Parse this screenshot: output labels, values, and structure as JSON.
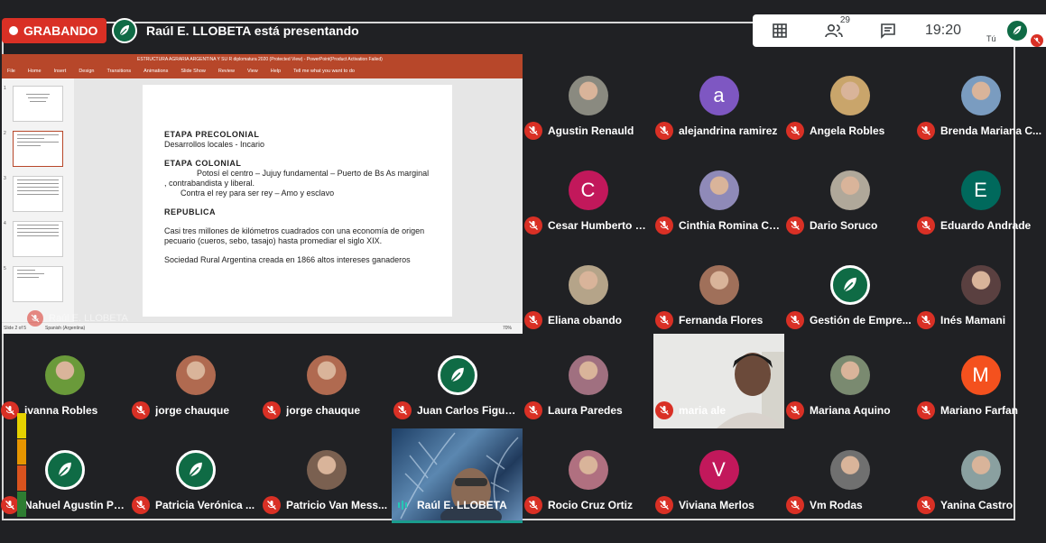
{
  "recording": {
    "label": "GRABANDO"
  },
  "presenting": {
    "text": "Raúl E. LLOBETA está presentando"
  },
  "toolbar": {
    "participant_count": "29",
    "time": "19:20",
    "self_label": "Tú"
  },
  "presentation": {
    "window_title": "ESTRUCTURA AGRARIA ARGENTINA Y SU R diplomatura 2020 (Protected View) - PowerPoint(Product Activation Failed)",
    "ribbon": [
      "File",
      "Home",
      "Insert",
      "Design",
      "Transitions",
      "Animations",
      "Slide Show",
      "Review",
      "View",
      "Help",
      "Tell me what you want to do"
    ],
    "presenter_label": "Raúl E. LLOBETA",
    "status_left": "Slide 2 of 5",
    "status_lang": "Spanish (Argentina)",
    "status_zoom": "70%",
    "slide": {
      "h1": "ETAPA PRECOLONIAL",
      "p1": "Desarrollos locales - Incario",
      "h2": "ETAPA COLONIAL",
      "p2a": "Potosí el centro – Jujuy fundamental – Puerto de Bs As marginal , contrabandista y liberal.",
      "p2b": "Contra el rey para ser rey – Amo y esclavo",
      "h3": "REPUBLICA",
      "p3": "Casi tres millones de kilómetros cuadrados con una economía de origen pecuario (cueros, sebo, tasajo) hasta promediar el siglo XIX.",
      "p4": "Sociedad Rural Argentina  creada en 1866 altos intereses ganaderos"
    }
  },
  "participants": [
    {
      "name": "Agustin Renauld",
      "avatar": "photo",
      "color": "#8a8a80"
    },
    {
      "name": "alejandrina ramirez",
      "avatar": "letter",
      "letter": "a",
      "color": "#7e57c2"
    },
    {
      "name": "Angela Robles",
      "avatar": "photo",
      "color": "#c9a56b"
    },
    {
      "name": "Brenda Mariana C...",
      "avatar": "photo",
      "color": "#7a9cc0"
    },
    {
      "name": "Cesar Humberto C...",
      "avatar": "letter",
      "letter": "C",
      "color": "#c2185b"
    },
    {
      "name": "Cinthia Romina Co...",
      "avatar": "photo",
      "color": "#8f8ab8"
    },
    {
      "name": "Dario Soruco",
      "avatar": "photo",
      "color": "#b0a89a"
    },
    {
      "name": "Eduardo Andrade",
      "avatar": "letter",
      "letter": "E",
      "color": "#00695c"
    },
    {
      "name": "Eliana obando",
      "avatar": "photo",
      "color": "#b5a489"
    },
    {
      "name": "Fernanda Flores",
      "avatar": "photo",
      "color": "#a0705a"
    },
    {
      "name": "Gestión de Empre...",
      "avatar": "logo"
    },
    {
      "name": "Inés Mamani",
      "avatar": "photo",
      "color": "#5a4040"
    },
    {
      "name": "ivanna Robles",
      "avatar": "photo",
      "color": "#6a9a3a"
    },
    {
      "name": "jorge chauque",
      "avatar": "photo",
      "color": "#b06a50"
    },
    {
      "name": "jorge chauque",
      "avatar": "photo",
      "color": "#b06a50"
    },
    {
      "name": "Juan Carlos Figuer...",
      "avatar": "logo"
    },
    {
      "name": "Laura Paredes",
      "avatar": "photo",
      "color": "#a07080"
    },
    {
      "name": "maria ale",
      "avatar": "video"
    },
    {
      "name": "Mariana Aquino",
      "avatar": "photo",
      "color": "#7a8a70"
    },
    {
      "name": "Mariano Farfan",
      "avatar": "letter",
      "letter": "M",
      "color": "#f4511e"
    },
    {
      "name": "Nahuel Agustin PO...",
      "avatar": "logo"
    },
    {
      "name": "Patricia Verónica ...",
      "avatar": "logo"
    },
    {
      "name": "Patricio Van Mess...",
      "avatar": "photo",
      "color": "#7a6050"
    },
    {
      "name": "Raúl E. LLOBETA",
      "avatar": "video"
    },
    {
      "name": "Rocio Cruz Ortiz",
      "avatar": "photo",
      "color": "#b07080"
    },
    {
      "name": "Viviana Merlos",
      "avatar": "letter",
      "letter": "V",
      "color": "#c2185b"
    },
    {
      "name": "Vm Rodas",
      "avatar": "photo",
      "color": "#707070"
    },
    {
      "name": "Yanina Castro",
      "avatar": "photo",
      "color": "#8aa0a0"
    }
  ],
  "colors": {
    "accent_red": "#d93025",
    "bg": "#202124",
    "brand_green": "#0f6b45"
  }
}
